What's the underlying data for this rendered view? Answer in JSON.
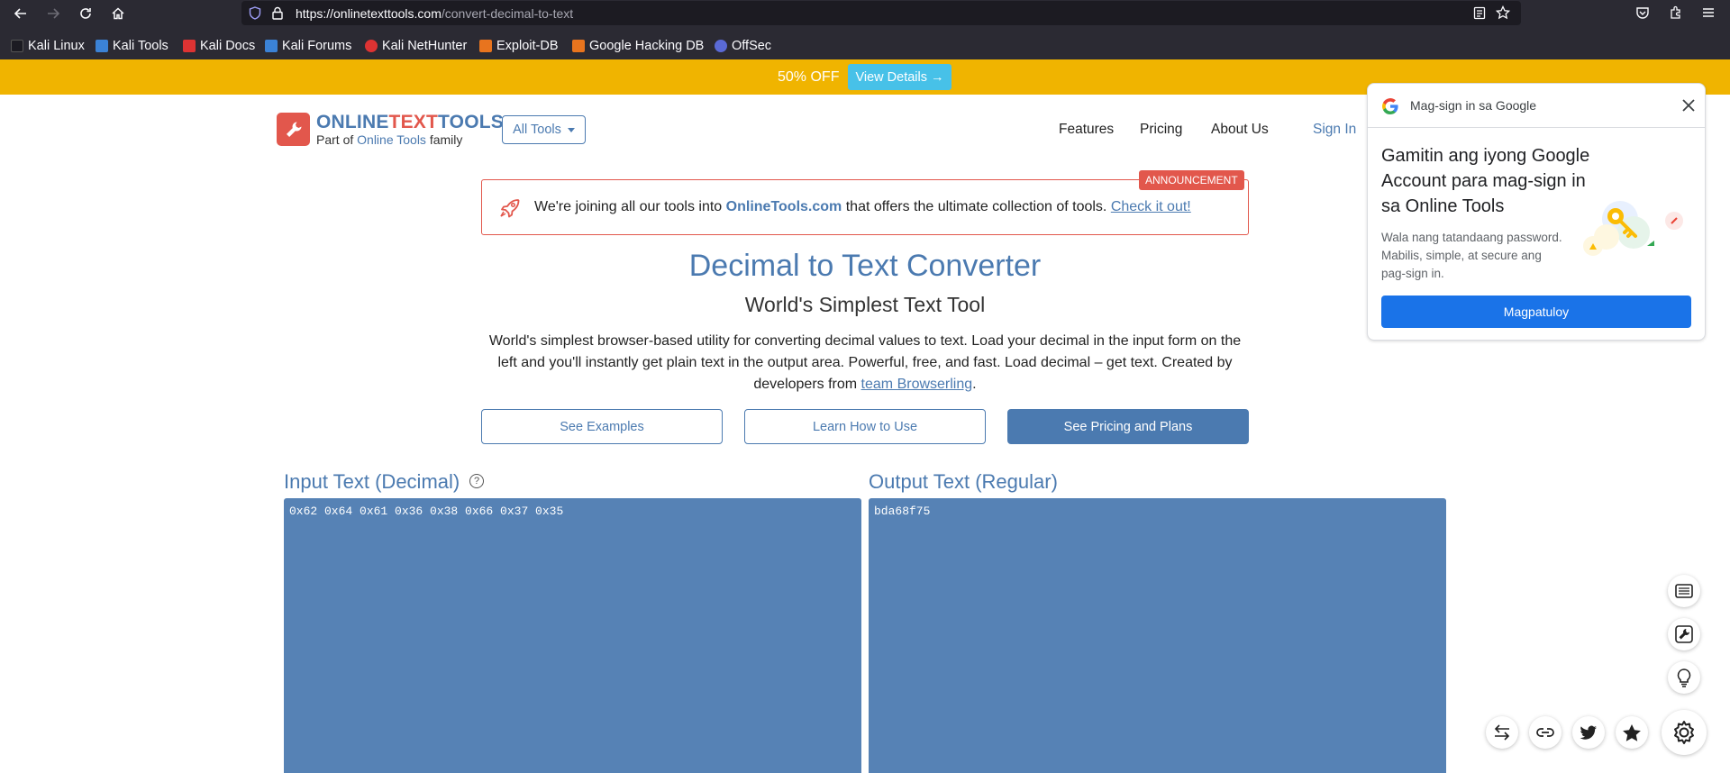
{
  "browser": {
    "url_host": "https://onlinetexttools.com",
    "url_path": "/convert-decimal-to-text",
    "bookmarks": [
      "Kali Linux",
      "Kali Tools",
      "Kali Docs",
      "Kali Forums",
      "Kali NetHunter",
      "Exploit-DB",
      "Google Hacking DB",
      "OffSec"
    ]
  },
  "promo": {
    "text": "50% OFF",
    "button": "View Details →"
  },
  "header": {
    "logo_part1": "ONLINE",
    "logo_part2": "TEXT",
    "logo_part3": "TOOLS",
    "sub_prefix": "Part of",
    "sub_link": "Online Tools",
    "sub_suffix": "family",
    "all_tools": "All Tools",
    "nav": [
      "Features",
      "Pricing",
      "About Us"
    ],
    "sign_in": "Sign In"
  },
  "announcement": {
    "badge": "ANNOUNCEMENT",
    "text_before": "We're joining all our tools into",
    "brand": "OnlineTools.com",
    "text_after": "that offers the ultimate collection of tools.",
    "link": "Check it out!"
  },
  "hero": {
    "title": "Decimal to Text Converter",
    "subtitle": "World's Simplest Text Tool",
    "description": "World's simplest browser-based utility for converting decimal values to text. Load your decimal in the input form on the left and you'll instantly get plain text in the output area. Powerful, free, and fast. Load decimal – get text. Created by developers from",
    "desc_link": "team Browserling",
    "desc_end": ".",
    "buttons": [
      "See Examples",
      "Learn How to Use",
      "See Pricing and Plans"
    ]
  },
  "tool": {
    "input_title": "Input Text (Decimal)",
    "input_value": "0x62 0x64 0x61 0x36 0x38 0x66 0x37 0x35",
    "output_title": "Output Text (Regular)",
    "output_value": "bda68f75"
  },
  "google_popup": {
    "header": "Mag-sign in sa Google",
    "heading": "Gamitin ang iyong Google Account para mag-sign in sa Online Tools",
    "body": "Wala nang tatandaang password. Mabilis, simple, at secure ang pag-sign in.",
    "button": "Magpatuloy"
  },
  "colors": {
    "brand_blue": "#4b7ab0",
    "brand_red": "#e2574c",
    "promo_yellow": "#f0b400",
    "panel_blue": "#5682b5",
    "google_blue": "#1a73e8"
  }
}
